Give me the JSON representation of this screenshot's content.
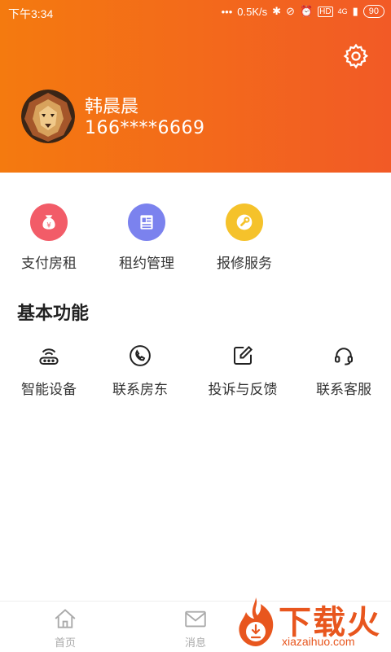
{
  "status_bar": {
    "time": "下午3:34",
    "speed": "0.5K/s",
    "network": "4G",
    "battery": "90",
    "hd": "HD"
  },
  "profile": {
    "name": "韩晨晨",
    "phone": "166****6669"
  },
  "quick_actions": [
    {
      "label": "支付房租",
      "icon": "money-bag-icon",
      "color": "#f25c68"
    },
    {
      "label": "租约管理",
      "icon": "contract-icon",
      "color": "#7b82ee"
    },
    {
      "label": "报修服务",
      "icon": "wrench-icon",
      "color": "#f5c22b"
    }
  ],
  "basic_section": {
    "title": "基本功能"
  },
  "basic_functions": [
    {
      "label": "智能设备",
      "icon": "router-icon"
    },
    {
      "label": "联系房东",
      "icon": "phone-icon"
    },
    {
      "label": "投诉与反馈",
      "icon": "edit-icon"
    },
    {
      "label": "联系客服",
      "icon": "headset-icon"
    }
  ],
  "tabs": [
    {
      "label": "首页",
      "icon": "home-icon"
    },
    {
      "label": "消息",
      "icon": "mail-icon"
    }
  ],
  "watermark": {
    "brand": "下载火",
    "url": "xiazaihuo.com"
  },
  "colors": {
    "header_start": "#f47a0f",
    "header_end": "#f25a26"
  }
}
